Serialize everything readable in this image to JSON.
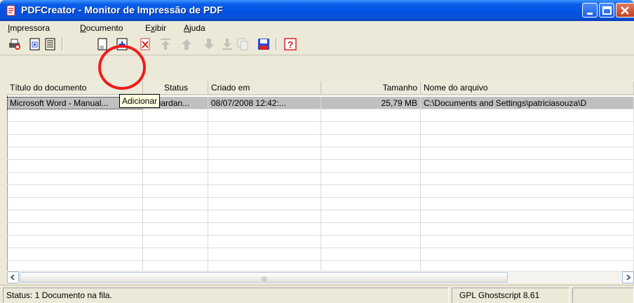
{
  "window": {
    "title": "PDFCreator - Monitor de Impressão de PDF"
  },
  "menu": [
    {
      "pre": "",
      "key": "I",
      "post": "mpressora"
    },
    {
      "pre": "",
      "key": "D",
      "post": "ocumento"
    },
    {
      "pre": "E",
      "key": "x",
      "post": "ibir"
    },
    {
      "pre": "",
      "key": "A",
      "post": "juda"
    }
  ],
  "toolbar": {
    "buttons": [
      "printer-icon",
      "document-settings-icon",
      "log-icon",
      "add-file-icon",
      "add-icon",
      "delete-icon",
      "move-top-icon",
      "move-up-icon",
      "move-down-icon",
      "move-bottom-icon",
      "duplicate-icon",
      "save-icon",
      "help-icon"
    ]
  },
  "tooltip": "Adicionar",
  "table": {
    "columns": [
      "Título do documento",
      "Status",
      "Criado em",
      "Tamanho",
      "Nome do arquivo"
    ],
    "rows": [
      [
        "Microsoft Word - Manual...",
        "Aguardan...",
        "08/07/2008 12:42:...",
        "25,79 MB",
        "C:\\Documents and Settings\\patriciasouza\\D"
      ]
    ]
  },
  "scrollbar": {
    "grip": "III"
  },
  "status": {
    "left": "Status: 1 Documento na fila.",
    "right": "GPL Ghostscript 8.61"
  },
  "colors": {
    "title_bar": "#0054e3",
    "highlight_circle": "#ef1c1c",
    "tooltip_bg": "#ffffe1",
    "selected_row": "#c0c0c0"
  }
}
